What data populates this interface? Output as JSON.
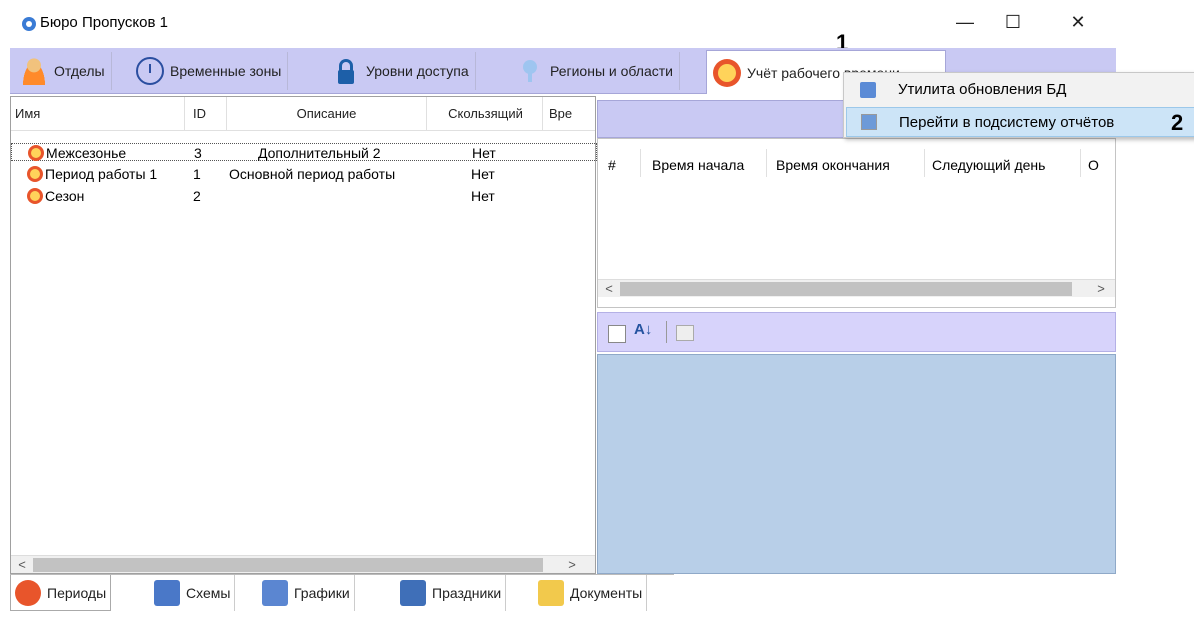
{
  "window": {
    "title": "Бюро Пропусков 1",
    "minimize": "—",
    "maximize": "☐",
    "close": "✕"
  },
  "tabs": [
    {
      "label": "Отделы",
      "icon": "person-icon"
    },
    {
      "label": "Временные зоны",
      "icon": "clock-icon"
    },
    {
      "label": "Уровни доступа",
      "icon": "lock-icon"
    },
    {
      "label": "Регионы и области",
      "icon": "pin-icon"
    },
    {
      "label": "Учёт рабочего времени",
      "icon": "time-icon"
    }
  ],
  "callouts": {
    "first": "1",
    "second": "2"
  },
  "left_table": {
    "columns": [
      "Имя",
      "ID",
      "Описание",
      "Скользящий",
      "Вре"
    ],
    "rows": [
      {
        "name": "Межсезонье",
        "id": "3",
        "desc": "Дополнительный 2",
        "sliding": "Нет"
      },
      {
        "name": "Период работы 1",
        "id": "1",
        "desc": "Основной период работы",
        "sliding": "Нет"
      },
      {
        "name": "Сезон",
        "id": "2",
        "desc": "",
        "sliding": "Нет"
      }
    ]
  },
  "right_table": {
    "columns": [
      "#",
      "Время начала",
      "Время окончания",
      "Следующий день",
      "О"
    ]
  },
  "scroll": {
    "left": "<",
    "right": ">"
  },
  "bottom_tabs": [
    {
      "label": "Периоды",
      "icon": "periods-icon"
    },
    {
      "label": "Схемы",
      "icon": "schemes-icon"
    },
    {
      "label": "Графики",
      "icon": "graphs-icon"
    },
    {
      "label": "Праздники",
      "icon": "holidays-icon"
    },
    {
      "label": "Документы",
      "icon": "documents-icon"
    }
  ],
  "context_menu": [
    {
      "label": "Утилита обновления БД",
      "icon": "db-update-icon"
    },
    {
      "label": "Перейти в подсистему отчётов",
      "icon": "reports-icon"
    }
  ],
  "colors": {
    "tabbar": "#c9c9f3",
    "property_area": "#b8cfe8",
    "accent_red": "#e8552b"
  }
}
